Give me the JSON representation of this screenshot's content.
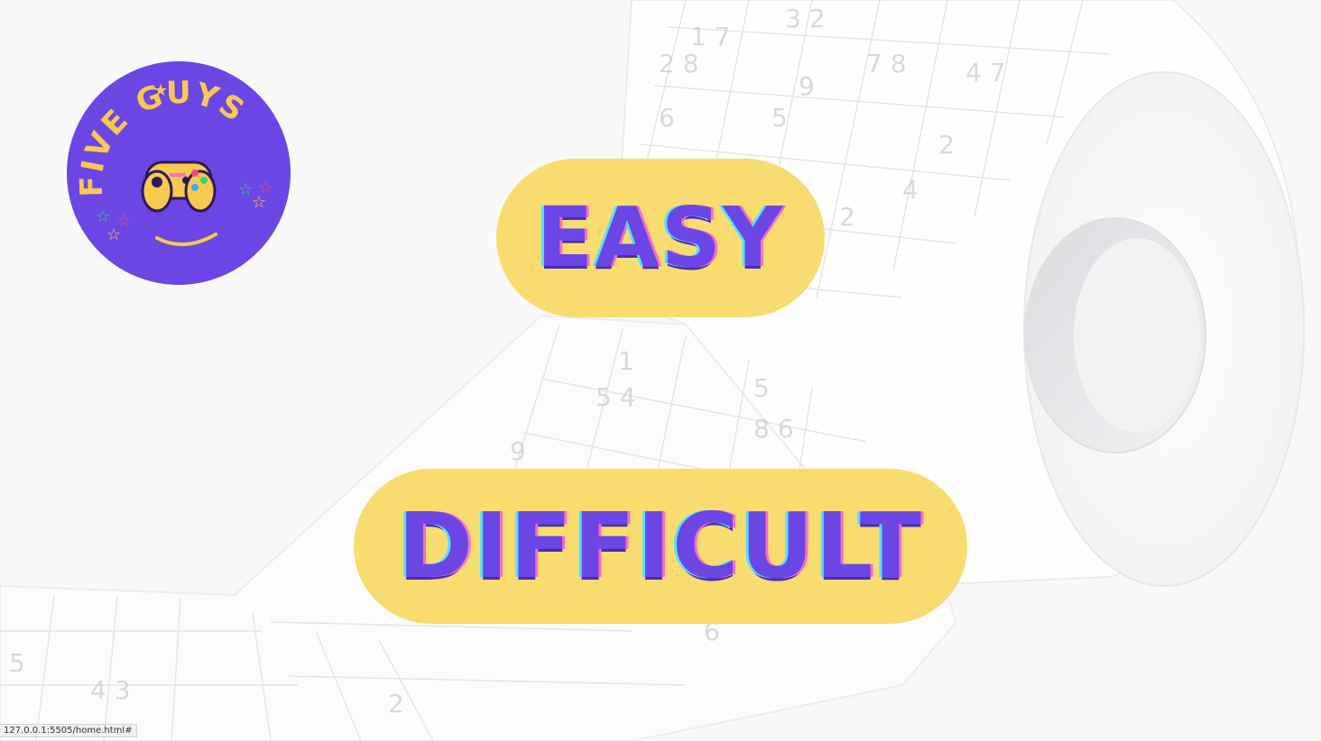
{
  "logo": {
    "text": "FIVE GUYS",
    "icon": "gamepad-icon",
    "bg_color": "#6b46e4",
    "text_color": "#f8c94f"
  },
  "menu": {
    "easy_label": "EASY",
    "difficult_label": "DIFFICULT"
  },
  "status": {
    "url": "127.0.0.1:5505/home.html#"
  },
  "colors": {
    "pill": "#f8dc70",
    "label": "#6b46e4",
    "accent_cyan": "#4ee3ff",
    "accent_pink": "#ff6bc1"
  }
}
